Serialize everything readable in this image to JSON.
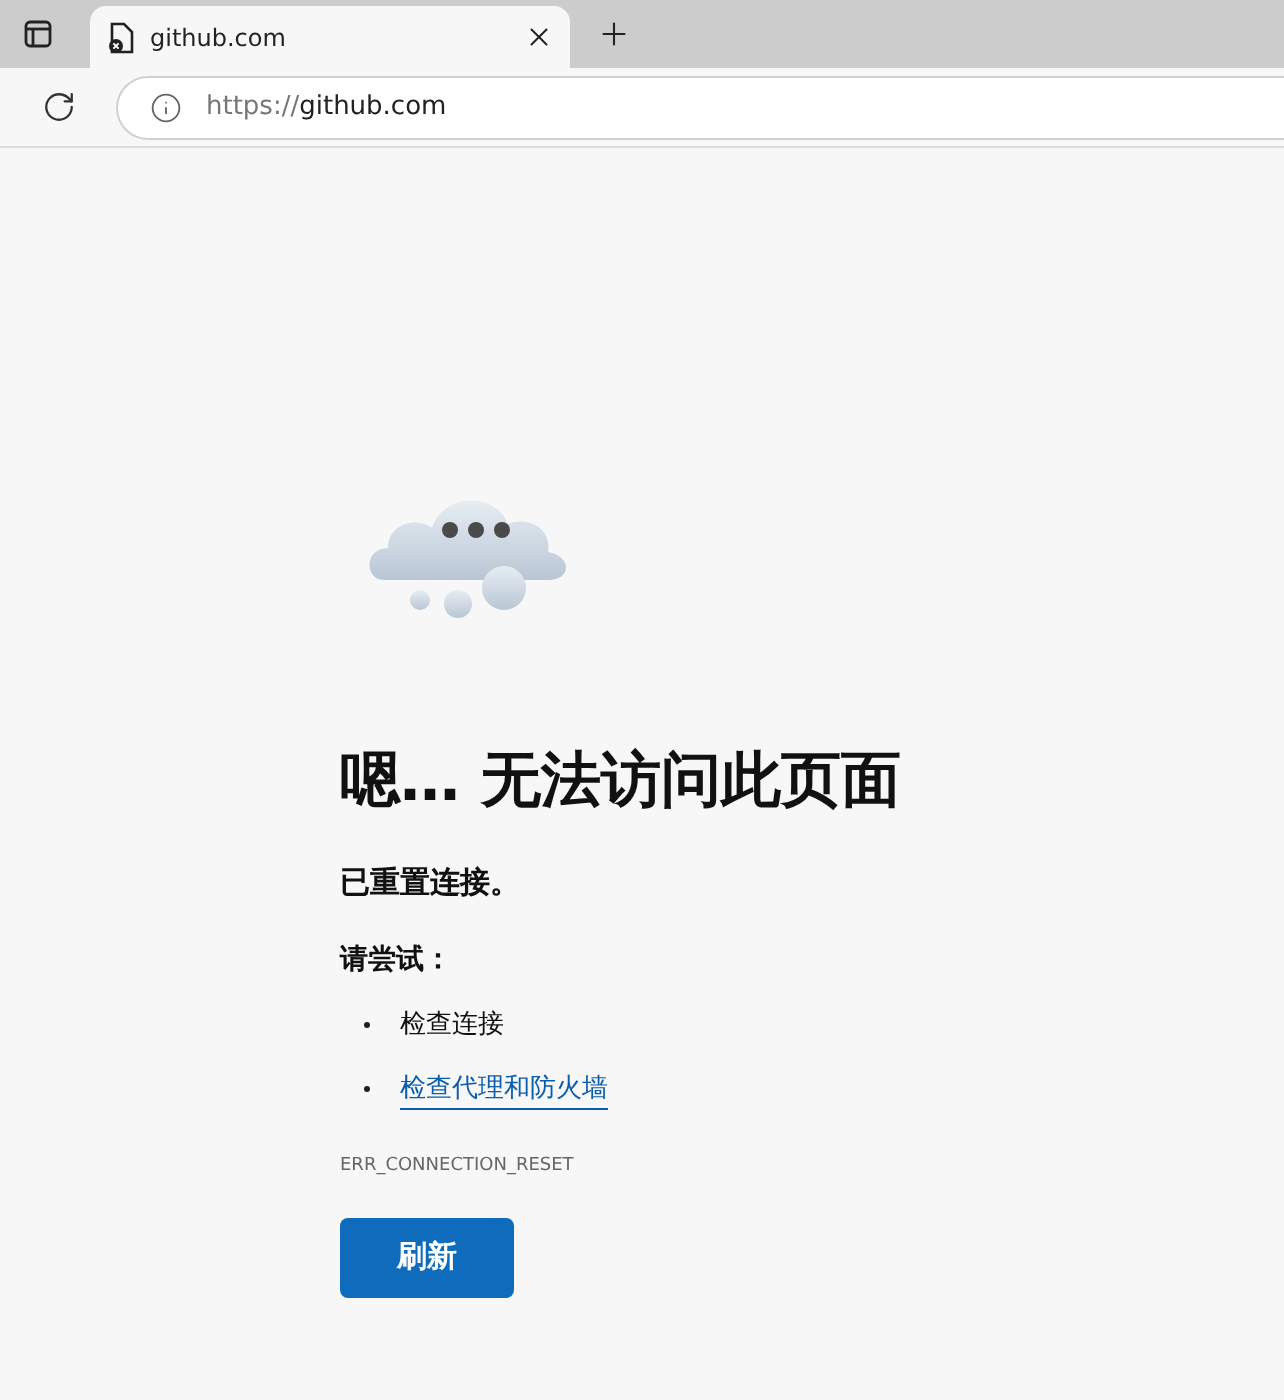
{
  "tabs": [
    {
      "title": "github.com",
      "selected": true
    }
  ],
  "address_bar": {
    "scheme": "https://",
    "host": "github.com"
  },
  "error": {
    "heading": "嗯… 无法访问此页面",
    "message": "已重置连接。",
    "try_label": "请尝试：",
    "suggestions": [
      {
        "kind": "text",
        "text": "检查连接"
      },
      {
        "kind": "link",
        "text": "检查代理和防火墙"
      }
    ],
    "code": "ERR_CONNECTION_RESET",
    "button": "刷新"
  }
}
